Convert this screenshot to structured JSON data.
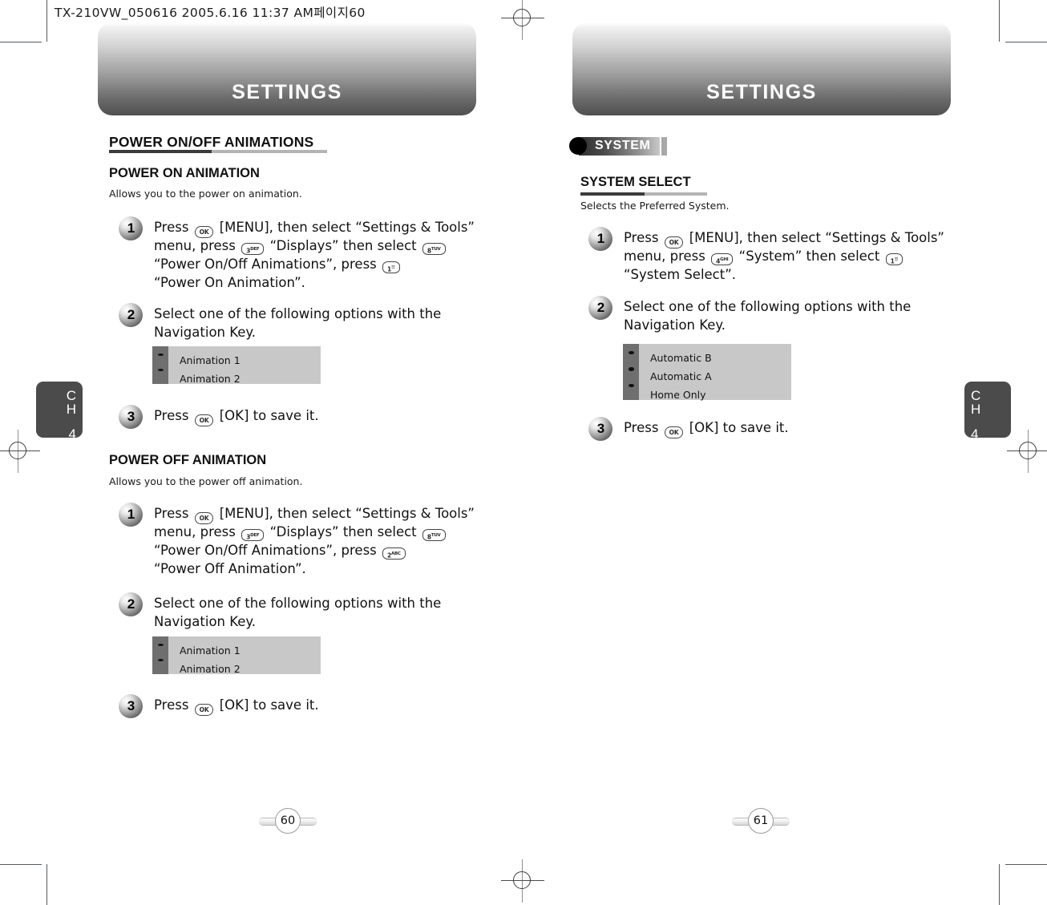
{
  "doc": {
    "header_caption": "TX-210VW_050616  2005.6.16  11:37 AM페이지60"
  },
  "left_page": {
    "banner_title": "SETTINGS",
    "chapter_tab": {
      "c": "C",
      "h": "H",
      "number": "4"
    },
    "page_number": "60",
    "section": {
      "title": "POWER ON/OFF ANIMATIONS"
    },
    "sub_sections": [
      {
        "title": "POWER ON ANIMATION",
        "description": "Allows you to the power on animation.",
        "steps": [
          {
            "number": "1",
            "lines": [
              {
                "parts": [
                  {
                    "t": "text",
                    "v": "Press "
                  },
                  {
                    "t": "key",
                    "v": "OK",
                    "style": "round"
                  },
                  {
                    "t": "text",
                    "v": " [MENU], then select “Settings & Tools”"
                  }
                ]
              },
              {
                "parts": [
                  {
                    "t": "text",
                    "v": "menu, press "
                  },
                  {
                    "t": "key",
                    "v": "3",
                    "sup": "DEF"
                  },
                  {
                    "t": "text",
                    "v": " “Displays” then select "
                  },
                  {
                    "t": "key",
                    "v": "8",
                    "sup": "TUV"
                  }
                ]
              },
              {
                "parts": [
                  {
                    "t": "text",
                    "v": "“Power On/Off Animations”, press "
                  },
                  {
                    "t": "key",
                    "v": "1",
                    "sup": "☰"
                  }
                ]
              },
              {
                "parts": [
                  {
                    "t": "text",
                    "v": "“Power On Animation”."
                  }
                ]
              }
            ]
          },
          {
            "number": "2",
            "lines": [
              {
                "parts": [
                  {
                    "t": "text",
                    "v": "Select one of the following options with the"
                  }
                ]
              },
              {
                "parts": [
                  {
                    "t": "text",
                    "v": "Navigation Key."
                  }
                ]
              }
            ],
            "options": [
              "Animation 1",
              "Animation 2"
            ]
          },
          {
            "number": "3",
            "lines": [
              {
                "parts": [
                  {
                    "t": "text",
                    "v": "Press "
                  },
                  {
                    "t": "key",
                    "v": "OK",
                    "style": "round"
                  },
                  {
                    "t": "text",
                    "v": " [OK] to save it."
                  }
                ]
              }
            ]
          }
        ]
      },
      {
        "title": "POWER OFF ANIMATION",
        "description": "Allows you to the power off animation.",
        "steps": [
          {
            "number": "1",
            "lines": [
              {
                "parts": [
                  {
                    "t": "text",
                    "v": "Press "
                  },
                  {
                    "t": "key",
                    "v": "OK",
                    "style": "round"
                  },
                  {
                    "t": "text",
                    "v": " [MENU], then select “Settings & Tools”"
                  }
                ]
              },
              {
                "parts": [
                  {
                    "t": "text",
                    "v": "menu, press "
                  },
                  {
                    "t": "key",
                    "v": "3",
                    "sup": "DEF"
                  },
                  {
                    "t": "text",
                    "v": " “Displays” then select "
                  },
                  {
                    "t": "key",
                    "v": "8",
                    "sup": "TUV"
                  }
                ]
              },
              {
                "parts": [
                  {
                    "t": "text",
                    "v": "“Power On/Off Animations”, press "
                  },
                  {
                    "t": "key",
                    "v": "2",
                    "sup": "ABC"
                  }
                ]
              },
              {
                "parts": [
                  {
                    "t": "text",
                    "v": "“Power Off Animation”."
                  }
                ]
              }
            ]
          },
          {
            "number": "2",
            "lines": [
              {
                "parts": [
                  {
                    "t": "text",
                    "v": "Select one of the following options with the"
                  }
                ]
              },
              {
                "parts": [
                  {
                    "t": "text",
                    "v": "Navigation Key."
                  }
                ]
              }
            ],
            "options": [
              "Animation 1",
              "Animation 2"
            ]
          },
          {
            "number": "3",
            "lines": [
              {
                "parts": [
                  {
                    "t": "text",
                    "v": "Press "
                  },
                  {
                    "t": "key",
                    "v": "OK",
                    "style": "round"
                  },
                  {
                    "t": "text",
                    "v": " [OK] to save it."
                  }
                ]
              }
            ]
          }
        ]
      }
    ]
  },
  "right_page": {
    "banner_title": "SETTINGS",
    "chapter_tab": {
      "c": "C",
      "h": "H",
      "number": "4"
    },
    "page_number": "61",
    "category_tag": "SYSTEM",
    "sub_sections": [
      {
        "title": "SYSTEM SELECT",
        "description": "Selects the Preferred System.",
        "steps": [
          {
            "number": "1",
            "lines": [
              {
                "parts": [
                  {
                    "t": "text",
                    "v": "Press "
                  },
                  {
                    "t": "key",
                    "v": "OK",
                    "style": "round"
                  },
                  {
                    "t": "text",
                    "v": " [MENU], then select “Settings & Tools”"
                  }
                ]
              },
              {
                "parts": [
                  {
                    "t": "text",
                    "v": "menu, press "
                  },
                  {
                    "t": "key",
                    "v": "4",
                    "sup": "GHI"
                  },
                  {
                    "t": "text",
                    "v": " “System” then select "
                  },
                  {
                    "t": "key",
                    "v": "1",
                    "sup": "☰"
                  }
                ]
              },
              {
                "parts": [
                  {
                    "t": "text",
                    "v": "“System Select”."
                  }
                ]
              }
            ]
          },
          {
            "number": "2",
            "lines": [
              {
                "parts": [
                  {
                    "t": "text",
                    "v": "Select one of the following options with the"
                  }
                ]
              },
              {
                "parts": [
                  {
                    "t": "text",
                    "v": "Navigation Key."
                  }
                ]
              }
            ],
            "options": [
              "Automatic B",
              "Automatic A",
              "Home Only"
            ]
          },
          {
            "number": "3",
            "lines": [
              {
                "parts": [
                  {
                    "t": "text",
                    "v": "Press "
                  },
                  {
                    "t": "key",
                    "v": "OK",
                    "style": "round"
                  },
                  {
                    "t": "text",
                    "v": " [OK] to save it."
                  }
                ]
              }
            ]
          }
        ]
      }
    ]
  }
}
